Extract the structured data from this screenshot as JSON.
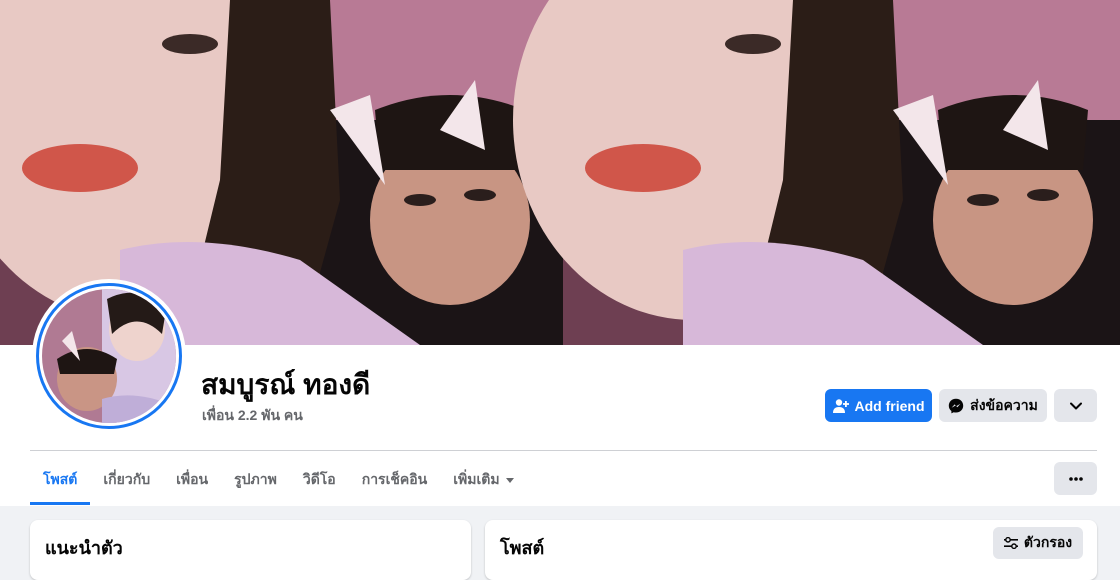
{
  "profile": {
    "name": "สมบูรณ์ ทองดี",
    "friend_count": "เพื่อน 2.2 พัน คน"
  },
  "actions": {
    "add_friend_label": "Add friend",
    "message_label": "ส่งข้อความ"
  },
  "tabs": [
    {
      "label": "โพสต์",
      "active": true
    },
    {
      "label": "เกี่ยวกับ"
    },
    {
      "label": "เพื่อน"
    },
    {
      "label": "รูปภาพ"
    },
    {
      "label": "วิดีโอ"
    },
    {
      "label": "การเช็คอิน"
    },
    {
      "label": "เพิ่มเติม"
    }
  ],
  "intro": {
    "title": "แนะนำตัว"
  },
  "posts": {
    "title": "โพสต์",
    "filter_label": "ตัวกรอง"
  },
  "colors": {
    "accent": "#1877f2",
    "secondary_button": "#e4e6eb",
    "muted_text": "#65676b",
    "page_background": "#f0f2f5"
  },
  "icons": {
    "add_friend": "person-plus-icon",
    "message": "messenger-icon",
    "more": "chevron-down-icon",
    "tab_more": "ellipsis-icon",
    "dropdown": "caret-down-icon",
    "filter": "sliders-icon"
  }
}
